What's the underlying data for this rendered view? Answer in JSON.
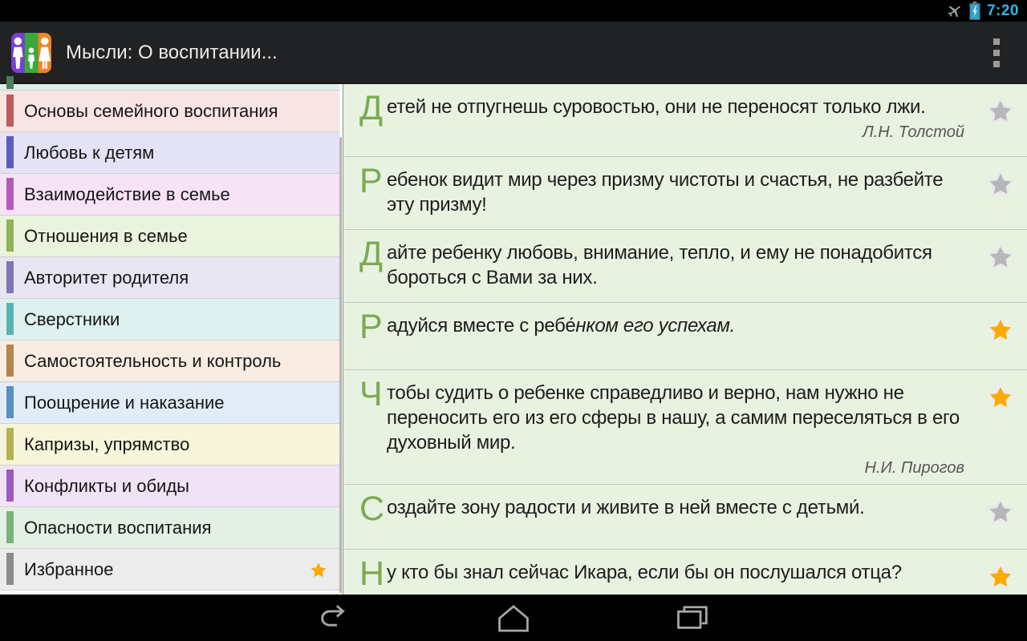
{
  "status_bar": {
    "time": "7:20",
    "accent_color": "#33b5e5",
    "icons": [
      "airplane-icon",
      "battery-charging-icon"
    ]
  },
  "action_bar": {
    "title": "Мысли: О воспитании...",
    "overflow_icon": "overflow-menu-icon"
  },
  "sidebar": {
    "partial_top_item": {
      "bg": "#dcefe9",
      "bar": "#4c7c5c"
    },
    "items": [
      {
        "label": "Основы семейного воспитания",
        "bg": "#f9e4e4",
        "bar": "#bf5b5b",
        "starred": false
      },
      {
        "label": "Любовь к детям",
        "bg": "#e3e3f5",
        "bar": "#5c5cc0",
        "starred": false
      },
      {
        "label": "Взаимодействие в семье",
        "bg": "#f6e3f6",
        "bar": "#b75ab7",
        "starred": false
      },
      {
        "label": "Отношения в семье",
        "bg": "#eaf3dd",
        "bar": "#8fb356",
        "starred": false
      },
      {
        "label": "Авторитет родителя",
        "bg": "#e7e5f2",
        "bar": "#7d77b5",
        "starred": false
      },
      {
        "label": "Сверстники",
        "bg": "#def0f0",
        "bar": "#5ab3b3",
        "starred": false
      },
      {
        "label": "Самостоятельность и контроль",
        "bg": "#f9ede3",
        "bar": "#b5854d",
        "starred": false
      },
      {
        "label": "Поощрение и наказание",
        "bg": "#e1ecf7",
        "bar": "#5a8fbf",
        "starred": false
      },
      {
        "label": "Капризы, упрямство",
        "bg": "#f7f5da",
        "bar": "#b3b356",
        "starred": false
      },
      {
        "label": "Конфликты и обиды",
        "bg": "#f1e3f6",
        "bar": "#9c5ac0",
        "starred": false
      },
      {
        "label": "Опасности воспитания",
        "bg": "#e4f0e4",
        "bar": "#79b379",
        "starred": false
      },
      {
        "label": "Избранное",
        "bg": "#ececec",
        "bar": "#8c8c8c",
        "starred": true
      }
    ]
  },
  "quotes": {
    "dropcap_color": "#7baa51",
    "list": [
      {
        "dropcap": "Д",
        "segments": [
          {
            "text": "етей не отпугнешь суровостью, они не переносят только лжи."
          }
        ],
        "author": "Л.Н. Толстой",
        "starred": false
      },
      {
        "dropcap": "Р",
        "segments": [
          {
            "text": "ебенок видит мир через призму чистоты и счастья, не разбейте эту призму!"
          }
        ],
        "author": "",
        "starred": false
      },
      {
        "dropcap": "Д",
        "segments": [
          {
            "text": "айте ребенку любовь, внимание, тепло, и ему не понадобится бороться с Вами за них."
          }
        ],
        "author": "",
        "starred": false
      },
      {
        "dropcap": "Р",
        "segments": [
          {
            "text": "адуйся вместе с ребе́"
          },
          {
            "text": "нком его успехам.",
            "italic": true
          }
        ],
        "author": "",
        "starred": true
      },
      {
        "dropcap": "Ч",
        "segments": [
          {
            "text": "тобы судить о ребенке справедливо и верно, нам нужно не переносить его из его сферы в нашу, а самим переселяться в его духовный мир."
          }
        ],
        "author": "Н.И. Пирогов",
        "starred": true
      },
      {
        "dropcap": "С",
        "segments": [
          {
            "text": "оздайте зону радости и живите в ней вместе с детьми́."
          }
        ],
        "author": "",
        "starred": false
      },
      {
        "dropcap": "Н",
        "segments": [
          {
            "text": "у кто бы знал сейчас Икара, если бы он послушался отца?"
          }
        ],
        "author": "",
        "starred": true
      }
    ]
  },
  "nav_bar": {
    "buttons": [
      "back",
      "home",
      "recents"
    ]
  }
}
